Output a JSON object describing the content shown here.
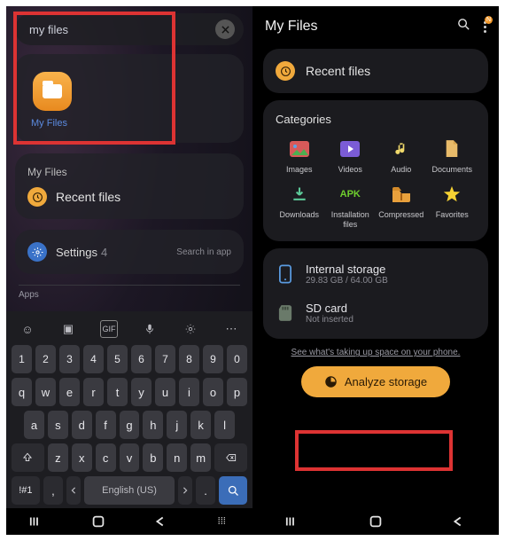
{
  "left": {
    "search": {
      "value": "my files"
    },
    "app_result": {
      "label": "My Files"
    },
    "myfiles_card": {
      "header": "My Files",
      "recent": "Recent files"
    },
    "settings_card": {
      "label": "Settings",
      "count": "4",
      "hint": "Search in app"
    },
    "apps_label": "Apps",
    "keyboard": {
      "num_row": [
        "1",
        "2",
        "3",
        "4",
        "5",
        "6",
        "7",
        "8",
        "9",
        "0"
      ],
      "row1": [
        "q",
        "w",
        "e",
        "r",
        "t",
        "y",
        "u",
        "i",
        "o",
        "p"
      ],
      "row2": [
        "a",
        "s",
        "d",
        "f",
        "g",
        "h",
        "j",
        "k",
        "l"
      ],
      "row3": [
        "z",
        "x",
        "c",
        "v",
        "b",
        "n",
        "m"
      ],
      "sym_key": "!#1",
      "comma": ",",
      "space_label": "English (US)",
      "period": "."
    }
  },
  "right": {
    "title": "My Files",
    "recent": "Recent files",
    "categories_title": "Categories",
    "categories": [
      {
        "label": "Images"
      },
      {
        "label": "Videos"
      },
      {
        "label": "Audio"
      },
      {
        "label": "Documents"
      },
      {
        "label": "Downloads"
      },
      {
        "label": "Installation files",
        "badge": "APK"
      },
      {
        "label": "Compressed"
      },
      {
        "label": "Favorites"
      }
    ],
    "storage": {
      "internal": {
        "title": "Internal storage",
        "sub": "29.83 GB / 64.00 GB"
      },
      "sd": {
        "title": "SD card",
        "sub": "Not inserted"
      }
    },
    "analyze": {
      "hint": "See what's taking up space on your phone.",
      "button": "Analyze storage"
    }
  },
  "colors": {
    "accent": "#f0a93c",
    "highlight": "#d33"
  }
}
